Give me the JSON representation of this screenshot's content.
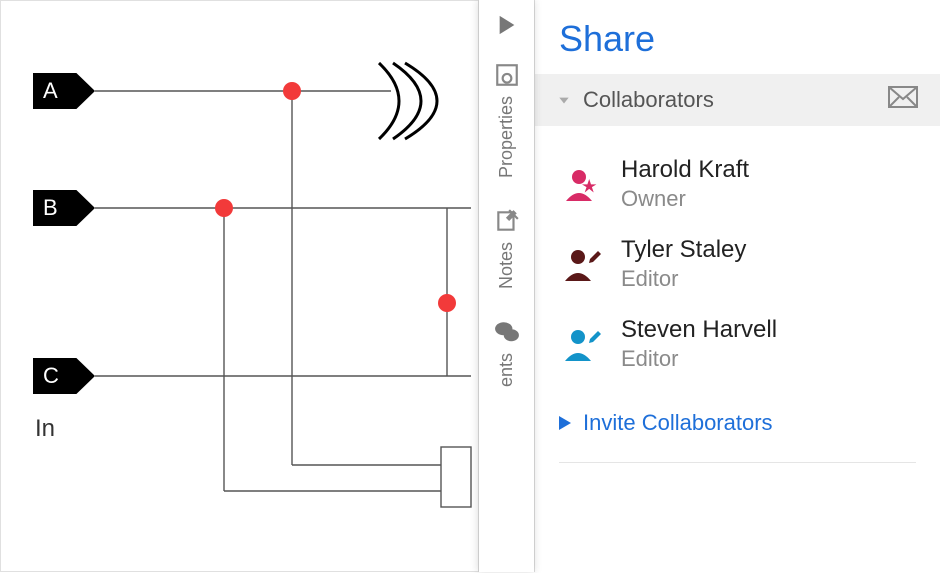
{
  "canvas": {
    "pin_a": "A",
    "pin_b": "B",
    "pin_c": "C",
    "in_label": "In"
  },
  "rail": {
    "properties": "Properties",
    "notes": "Notes",
    "comments": "ents"
  },
  "panel": {
    "title": "Share",
    "section_collaborators": "Collaborators",
    "invite_label": "Invite Collaborators",
    "collaborators": [
      {
        "name": "Harold Kraft",
        "role": "Owner",
        "icon": "owner"
      },
      {
        "name": "Tyler Staley",
        "role": "Editor",
        "icon": "editor-dark"
      },
      {
        "name": "Steven Harvell",
        "role": "Editor",
        "icon": "editor-blue"
      }
    ]
  }
}
